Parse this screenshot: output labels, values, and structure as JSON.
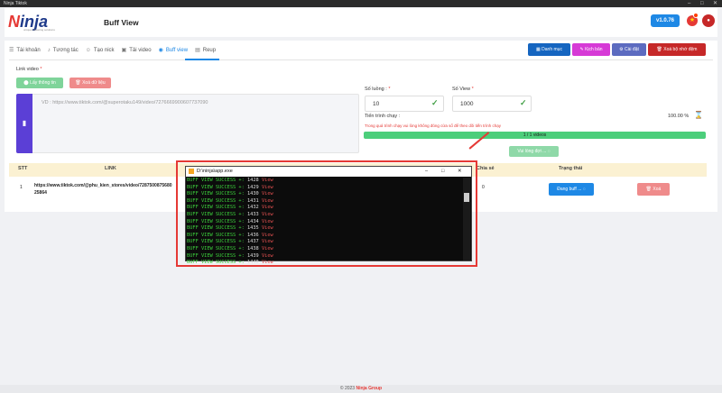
{
  "window": {
    "title": "Ninja Tiktok"
  },
  "header": {
    "logo_text": "Ninja",
    "logo_sub": "uniquemarketing solutions",
    "page_title": "Buff View",
    "version": "v1.0.76"
  },
  "tabs": [
    "Tài khoản",
    "Tương tác",
    "Tạo nick",
    "Tải video",
    "Buff view",
    "Reup"
  ],
  "toolbar": {
    "danh_muc": "Danh mục",
    "kich_ban": "Kịch bản",
    "cai_dat": "Cài đặt",
    "xoa_bo_nho_dem": "Xoá bộ nhớ đệm"
  },
  "form": {
    "link_label": "Link video",
    "get_info": "Lấy thông tin",
    "clear_data": "Xoá dữ liệu",
    "placeholder": "VD : https://www.tiktok.com/@superotaku149/video/7276669900607737090",
    "threads_label": "Số luồng :",
    "threads_value": "10",
    "views_label": "Số View",
    "views_value": "1000",
    "progress_label": "Tiến trình chạy :",
    "progress_percent": "100.00 %",
    "warning": "Trong quá trình chạy vui lòng không đóng cửa sổ để theo dõi tiến trình chạy",
    "progress_text": "1 / 1 videos",
    "progress_fraction": 1.0,
    "waiting_btn": "Vui lòng đợi ..."
  },
  "table": {
    "headers": {
      "stt": "STT",
      "link": "LINK",
      "chiase": "Chia sẻ",
      "trangthai": "Trạng thái"
    },
    "rows": [
      {
        "stt": "1",
        "link": "https://www.tiktok.com/@phu_kien_stores/video/7287500875680",
        "link2": "25864",
        "share": "0",
        "status_btn": "Đang buff ...",
        "delete_btn": "Xoá"
      }
    ]
  },
  "console": {
    "title": "D:\\ninja\\app.exe",
    "prefix": "BUFF VIEW SUCCESS",
    "suffix": "View",
    "counts": [
      "1428",
      "1429",
      "1430",
      "1431",
      "1432",
      "1433",
      "1434",
      "1435",
      "1436",
      "1437",
      "1438",
      "1439",
      "1440"
    ]
  },
  "footer": {
    "copyright": "© 2023",
    "brand": "Ninja Group"
  },
  "colors": {
    "accent": "#1e88e5",
    "danger": "#e53935",
    "success": "#4cce7b",
    "purple": "#5b3fd6"
  }
}
